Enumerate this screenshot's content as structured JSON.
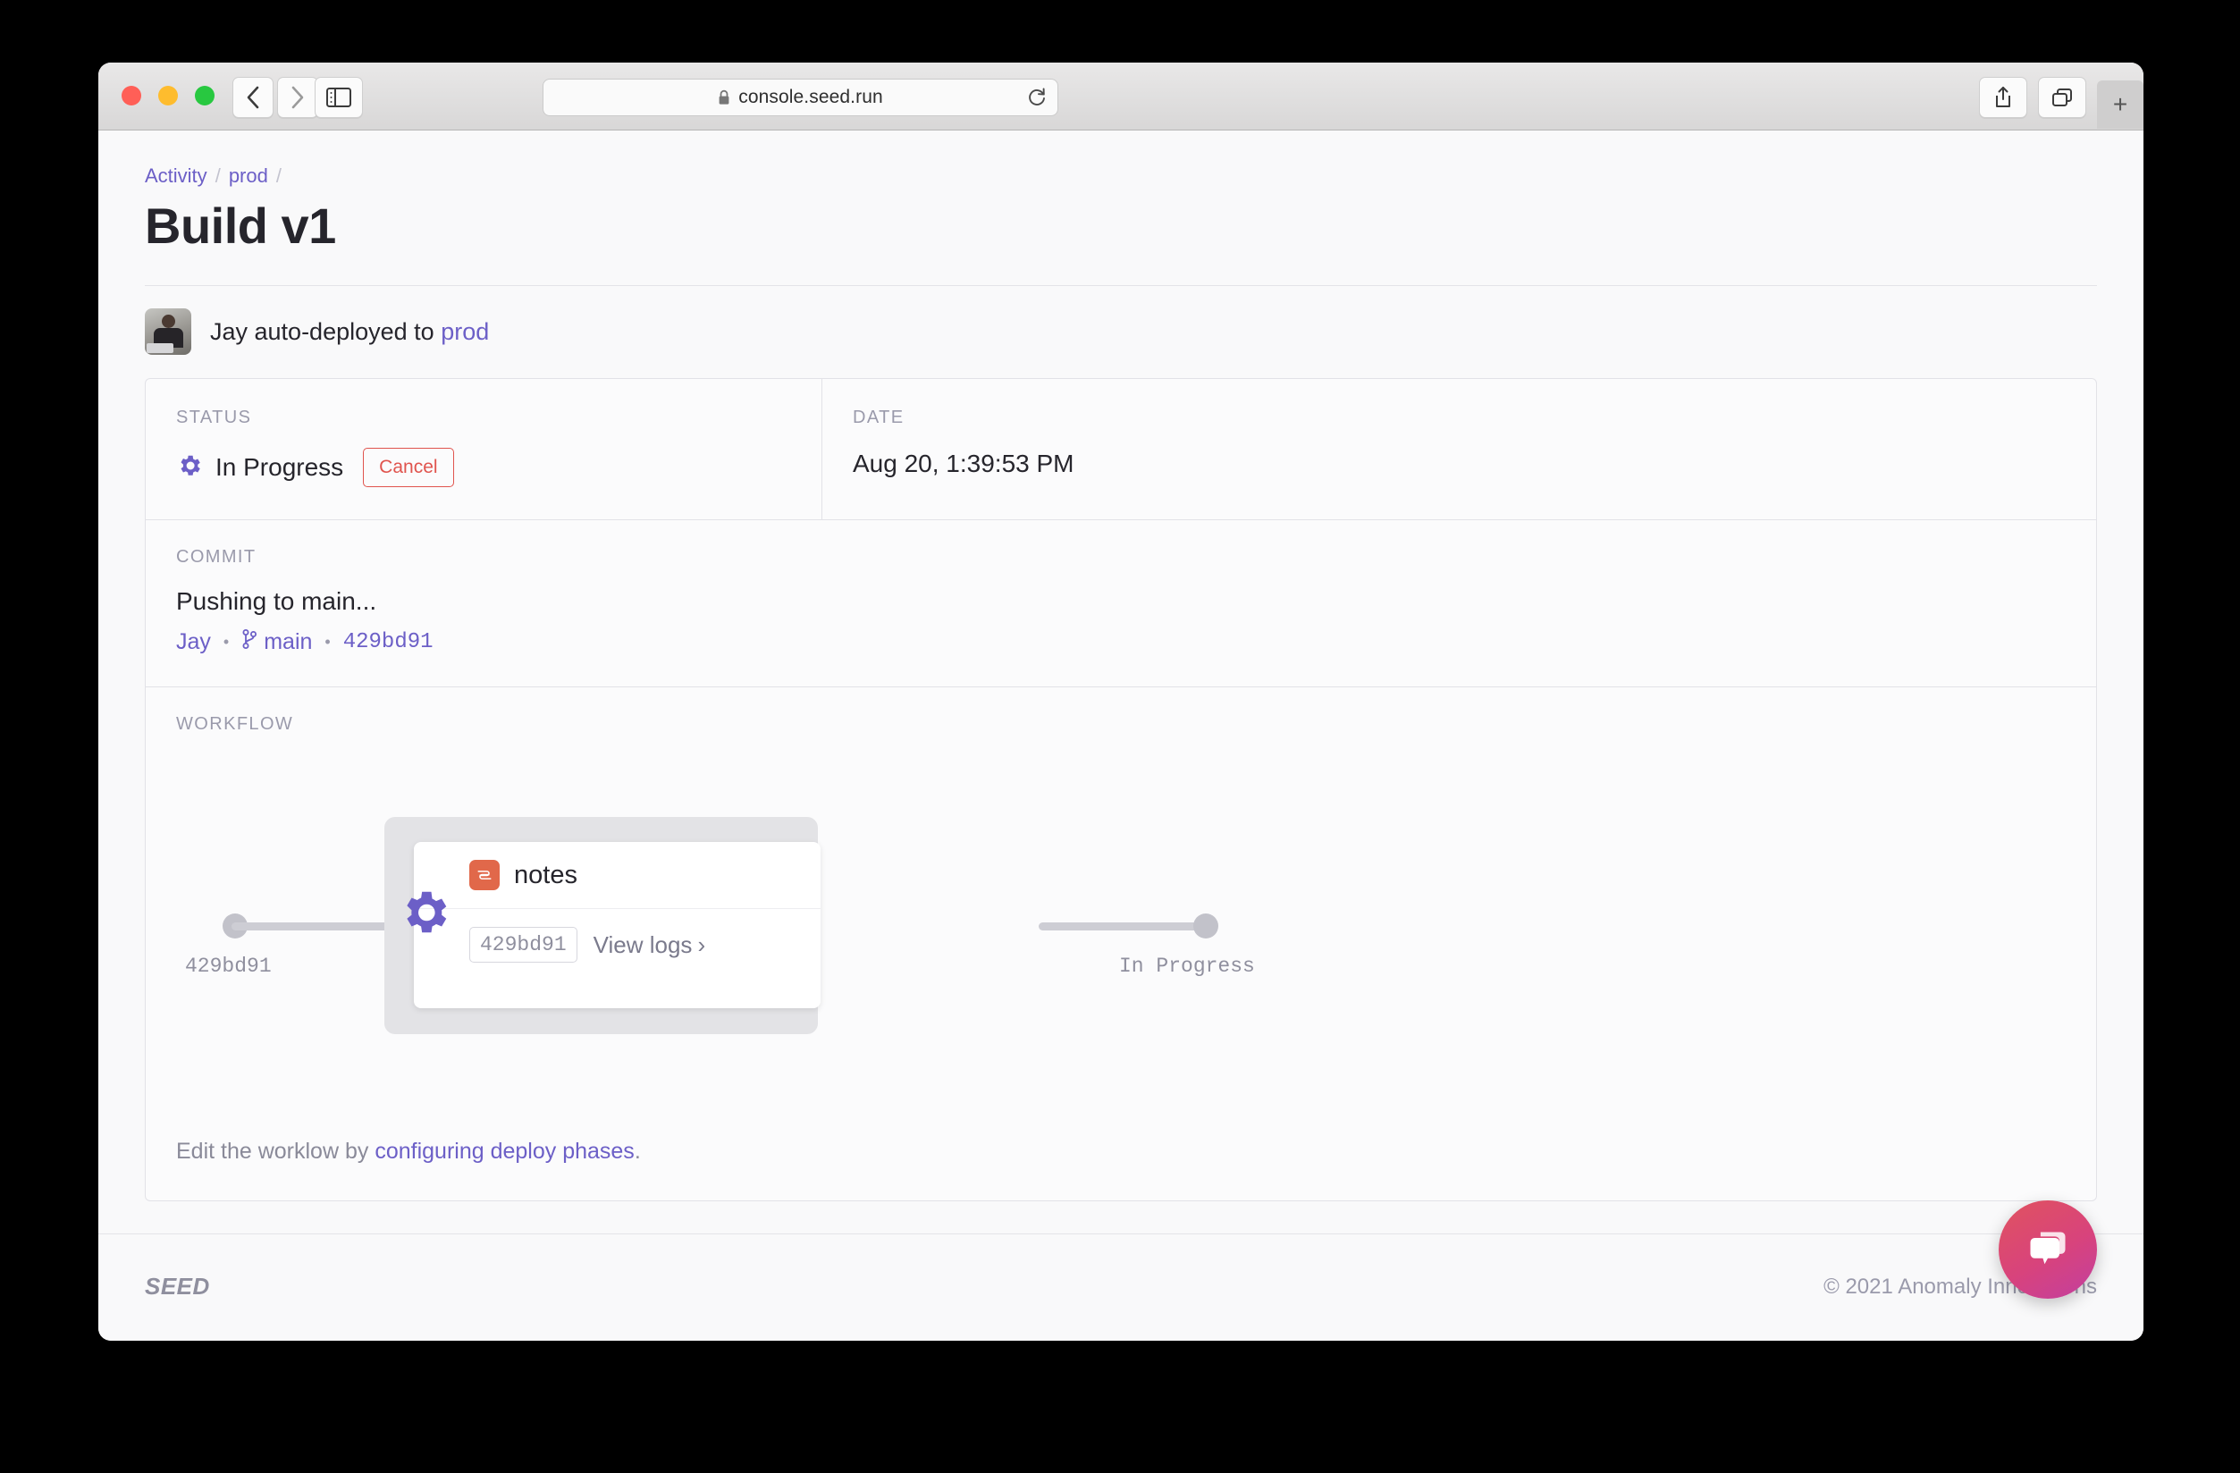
{
  "browser": {
    "url": "console.seed.run",
    "back_label": "Back",
    "forward_label": "Forward",
    "sidebar_label": "Show Sidebar",
    "reload_label": "Reload",
    "share_label": "Share",
    "tabs_label": "Tab Overview",
    "newtab_label": "+"
  },
  "breadcrumb": {
    "items": [
      {
        "label": "Activity"
      },
      {
        "label": "prod"
      }
    ],
    "separator": "/"
  },
  "header": {
    "title": "Build v1"
  },
  "deployment": {
    "text_before": "Jay auto-deployed to ",
    "stage_link": "prod"
  },
  "status": {
    "label": "STATUS",
    "value": "In Progress",
    "cancel_label": "Cancel",
    "icon": "gear-icon",
    "color": "#6c5fc7"
  },
  "date": {
    "label": "DATE",
    "value": "Aug 20, 1:39:53 PM"
  },
  "commit": {
    "label": "COMMIT",
    "message": "Pushing to main...",
    "author": "Jay",
    "branch": "main",
    "hash": "429bd91",
    "bullet": "•"
  },
  "workflow": {
    "label": "WORKFLOW",
    "start_node_label": "429bd91",
    "end_node_label": "In Progress",
    "phase": {
      "name": "notes",
      "service_icon": "cloudformation-stack-icon",
      "hash": "429bd91",
      "view_logs_label": "View logs",
      "chevron": "›"
    },
    "note_prefix": "Edit the worklow by ",
    "note_link": "configuring deploy phases",
    "note_suffix": "."
  },
  "footer": {
    "logo": "SEED",
    "copyright": "© 2021 Anomaly Innovations"
  },
  "chat": {
    "label": "chat-bubble-icon",
    "color": "#d8437c"
  }
}
